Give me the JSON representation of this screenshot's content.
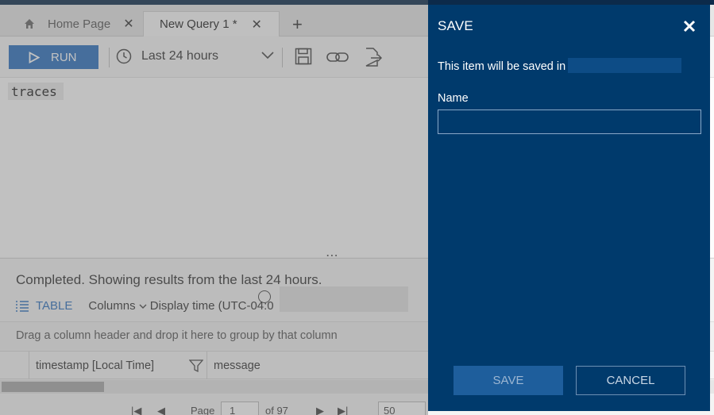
{
  "tabs": {
    "home_label": "Home Page",
    "active_label": "New Query 1 *",
    "close_glyph": "✕",
    "new_tab_glyph": "+"
  },
  "toolbar": {
    "run_label": "RUN",
    "time_range": "Last 24 hours"
  },
  "editor": {
    "query": "traces"
  },
  "results": {
    "status": "Completed. Showing results from the last 24 hours.",
    "table_label": "TABLE",
    "columns_label": "Columns",
    "display_time": "Display time (UTC-04:0",
    "group_hint": "Drag a column header and drop it here to group by that column",
    "headers": [
      "timestamp [Local Time]",
      "message"
    ],
    "pager": {
      "page_label": "Page",
      "page_value": "1",
      "of_label": "of 97",
      "page_size": "50"
    }
  },
  "save_panel": {
    "title": "SAVE",
    "saved_in_text": "This item will be saved in",
    "name_label": "Name",
    "name_value": "",
    "save_label": "SAVE",
    "cancel_label": "CANCEL"
  },
  "colors": {
    "panel_bg": "#003a6c",
    "accent_blue": "#2a6fbd"
  },
  "icons": [
    "home-icon",
    "close-icon",
    "plus-icon",
    "play-icon",
    "clock-icon",
    "chevron-down-icon",
    "save-icon",
    "link-icon",
    "export-icon",
    "table-icon",
    "funnel-icon"
  ]
}
